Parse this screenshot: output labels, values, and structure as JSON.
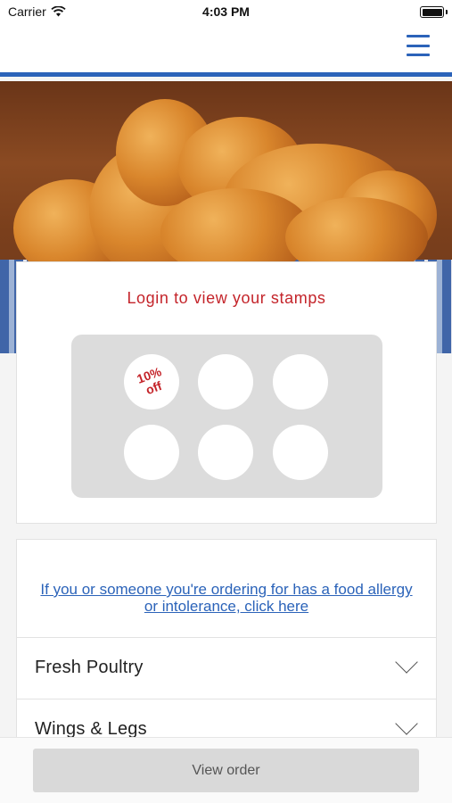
{
  "status_bar": {
    "carrier": "Carrier",
    "time": "4:03 PM",
    "battery_icon": "battery-full-icon",
    "wifi_icon": "wifi-icon"
  },
  "header": {
    "menu_icon": "hamburger-menu-icon",
    "accent_color": "#2b63b9"
  },
  "hero": {
    "image": "fried-chicken-photo"
  },
  "stamps": {
    "title": "Login to view your stamps",
    "title_color": "#c4242a",
    "reward_label": "10%\noff",
    "total_stamps": 6,
    "filled_stamps": 0
  },
  "allergy": {
    "link_text": "If you or someone you're ordering for has a food allergy or intolerance, click here"
  },
  "categories": [
    {
      "label": "Fresh Poultry",
      "icon": "chevron-down-icon"
    },
    {
      "label": "Wings & Legs",
      "icon": "chevron-down-icon"
    }
  ],
  "footer": {
    "view_order_label": "View order"
  }
}
